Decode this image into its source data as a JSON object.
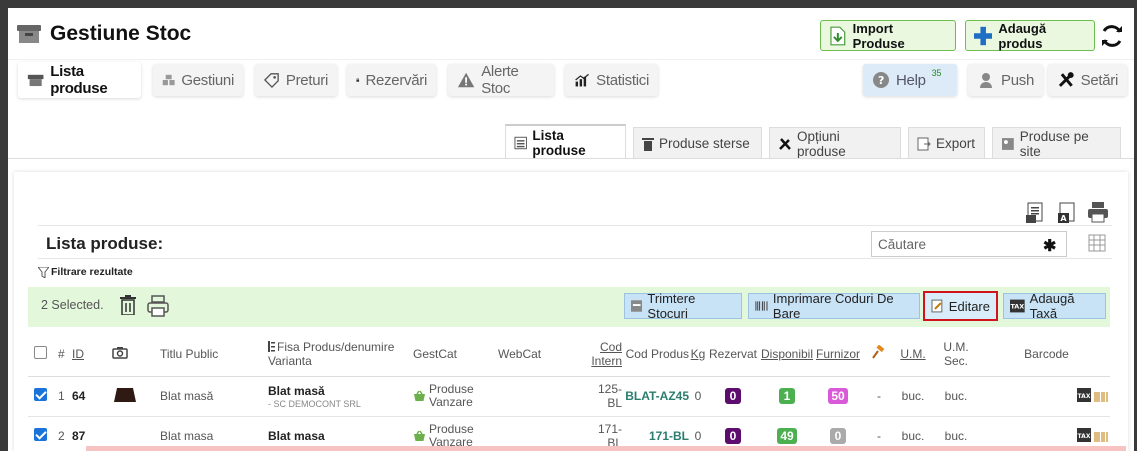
{
  "app": {
    "title": "Gestiune Stoc"
  },
  "header": {
    "import_label": "Import Produse",
    "add_label": "Adaugă produs"
  },
  "main_tabs": {
    "lista": "Lista produse",
    "gestiuni": "Gestiuni",
    "preturi": "Preturi",
    "rezervari": "Rezervări",
    "alerte": "Alerte Stoc",
    "statistici": "Statistici",
    "help": "Help",
    "help_count": "35",
    "push": "Push",
    "setari": "Setări"
  },
  "sub_tabs": {
    "lista": "Lista produse",
    "sterse": "Produse sterse",
    "optiuni": "Opțiuni produse",
    "export": "Export",
    "site": "Produse pe site"
  },
  "list": {
    "title": "Lista produse:",
    "search_placeholder": "Căutare",
    "filter_label": "Filtrare rezultate",
    "selected_text": "2 Selected."
  },
  "actions": {
    "trimitere": "Trimtere Stocuri",
    "imprimare": "Imprimare Coduri De Bare",
    "editare": "Editare",
    "taxa": "Adaugă Taxă"
  },
  "columns": {
    "num": "#",
    "id": "ID",
    "titlu": "Titlu Public",
    "fisa_line1": "Fisa Produs/denumire",
    "fisa_line2": "Varianta",
    "gestcat": "GestCat",
    "webcat": "WebCat",
    "cod_intern_line1": "Cod",
    "cod_intern_line2": "Intern",
    "cod_produs": "Cod Produs",
    "kg": "Kg",
    "rezervat": "Rezervat",
    "disponibil": "Disponibil",
    "furnizor": "Furnizor",
    "um": "U.M.",
    "um_sec_line1": "U.M.",
    "um_sec_line2": "Sec.",
    "barcode": "Barcode"
  },
  "rows": [
    {
      "num": "1",
      "id": "64",
      "titlu": "Blat masă",
      "fisa": "Blat masă",
      "fisa_sub": "- SC DEMOCONT SRL",
      "gest_line1": "Produse",
      "gest_line2": "Vanzare",
      "cod_intern": "125-BL",
      "cod_produs": "BLAT-AZ45",
      "kg": "0",
      "rezervat": "0",
      "disponibil": "1",
      "furnizor": "50",
      "dash": "-",
      "um": "buc.",
      "um_sec": "buc."
    },
    {
      "num": "2",
      "id": "87",
      "titlu": "Blat masa",
      "fisa": "Blat masa",
      "fisa_sub": "",
      "gest_line1": "Produse",
      "gest_line2": "Vanzare",
      "cod_intern": "171-BL",
      "cod_produs": "171-BL",
      "kg": "0",
      "rezervat": "0",
      "disponibil": "49",
      "furnizor": "0",
      "dash": "-",
      "um": "buc.",
      "um_sec": "buc."
    }
  ],
  "colors": {
    "accent_green": "#6cbf4e",
    "highlight_red": "#d0141c",
    "action_blue": "#c8e2f6"
  }
}
